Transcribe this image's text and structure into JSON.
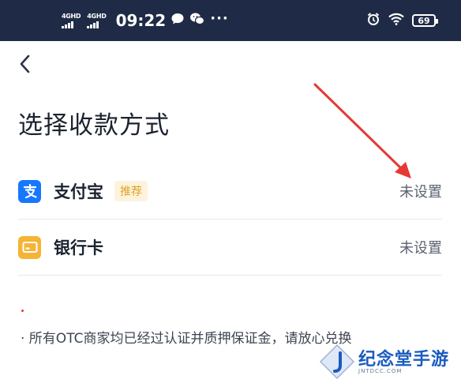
{
  "status_bar": {
    "network_1": "4GHD",
    "network_2": "4GHD",
    "time": "09:22",
    "dots": "···",
    "battery": "69"
  },
  "page": {
    "title": "选择收款方式"
  },
  "payment_methods": [
    {
      "name": "支付宝",
      "badge": "推荐",
      "status": "未设置",
      "icon": "alipay-icon",
      "color": "#1677ff"
    },
    {
      "name": "银行卡",
      "status": "未设置",
      "icon": "bank-card-icon",
      "color": "#f5b434"
    }
  ],
  "notes": {
    "line1": "· 所有OTC商家均已经过认证并质押保证金，请放心兑换"
  },
  "watermark": {
    "text": "纪念堂手游",
    "sub": "JNTDCC.COM"
  },
  "colors": {
    "status_bar_bg": "#1f2b46",
    "annotation_arrow": "#e53935",
    "badge_text": "#e0a125"
  }
}
